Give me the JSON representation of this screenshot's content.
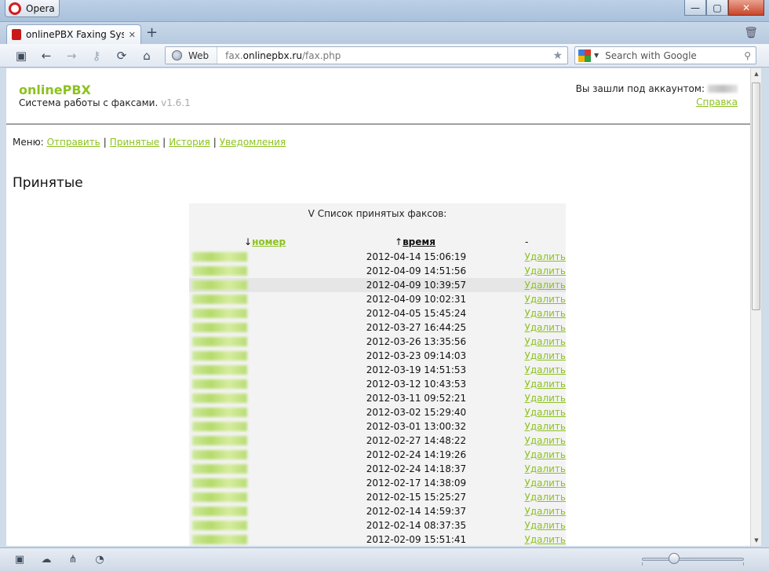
{
  "window": {
    "app_button_label": "Opera",
    "minimize": "—",
    "maximize": "▢",
    "close": "✕"
  },
  "tab": {
    "title": "onlinePBX Faxing System",
    "close": "✕"
  },
  "toolbar": {
    "addr_scheme_label": "Web",
    "url_prefix": "fax.",
    "url_domain": "onlinepbx.ru",
    "url_path": "/fax.php",
    "search_placeholder": "Search with Google"
  },
  "header": {
    "brand": "onlinePBX",
    "subtitle": "Система работы с факсами.",
    "version": "v1.6.1",
    "account_label": "Вы зашли под аккаунтом:",
    "help_link": "Справка"
  },
  "menu": {
    "label": "Меню:",
    "items": [
      "Отправить",
      "Принятые",
      "История",
      "Уведомления"
    ]
  },
  "page_title": "Принятые",
  "fax_list": {
    "caption": "Список принятых факсов:",
    "columns": {
      "number": "номер",
      "time": "время",
      "action": "-"
    },
    "delete_label": "Удалить",
    "rows": [
      {
        "time": "2012-04-14 15:06:19",
        "highlight": false
      },
      {
        "time": "2012-04-09 14:51:56",
        "highlight": false
      },
      {
        "time": "2012-04-09 10:39:57",
        "highlight": true
      },
      {
        "time": "2012-04-09 10:02:31",
        "highlight": false
      },
      {
        "time": "2012-04-05 15:45:24",
        "highlight": false
      },
      {
        "time": "2012-03-27 16:44:25",
        "highlight": false
      },
      {
        "time": "2012-03-26 13:35:56",
        "highlight": false
      },
      {
        "time": "2012-03-23 09:14:03",
        "highlight": false
      },
      {
        "time": "2012-03-19 14:51:53",
        "highlight": false
      },
      {
        "time": "2012-03-12 10:43:53",
        "highlight": false
      },
      {
        "time": "2012-03-11 09:52:21",
        "highlight": false
      },
      {
        "time": "2012-03-02 15:29:40",
        "highlight": false
      },
      {
        "time": "2012-03-01 13:00:32",
        "highlight": false
      },
      {
        "time": "2012-02-27 14:48:22",
        "highlight": false
      },
      {
        "time": "2012-02-24 14:19:26",
        "highlight": false
      },
      {
        "time": "2012-02-24 14:18:37",
        "highlight": false
      },
      {
        "time": "2012-02-17 14:38:09",
        "highlight": false
      },
      {
        "time": "2012-02-15 15:25:27",
        "highlight": false
      },
      {
        "time": "2012-02-14 14:59:37",
        "highlight": false
      },
      {
        "time": "2012-02-14 08:37:35",
        "highlight": false
      },
      {
        "time": "2012-02-09 15:51:41",
        "highlight": false
      }
    ]
  },
  "colors": {
    "accent_green": "#8cc21f",
    "table_bg": "#f3f3f3",
    "row_highlight": "#e6e6e6"
  },
  "icons": {
    "sort_desc": "↓",
    "sort_asc": "↑",
    "caption_toggle": "V",
    "back": "back-arrow-icon",
    "forward": "forward-arrow-icon",
    "reload": "reload-icon",
    "home": "home-icon"
  }
}
